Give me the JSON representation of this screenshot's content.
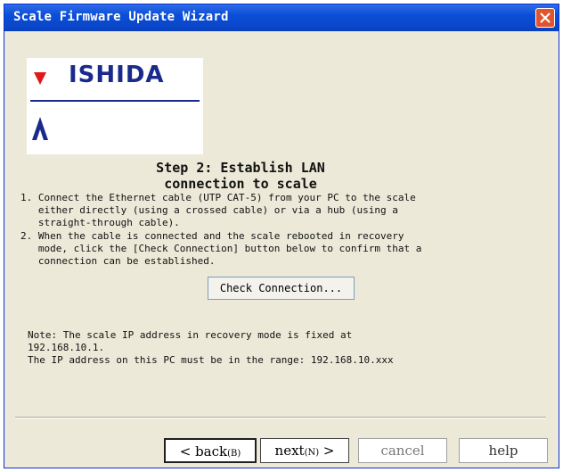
{
  "window": {
    "title": "Scale Firmware Update Wizard",
    "close_icon": "close-icon"
  },
  "logo": {
    "brand": "ISHIDA"
  },
  "step": {
    "heading_line1": "Step 2:  Establish LAN",
    "heading_line2": "connection to scale"
  },
  "instructions": [
    {
      "lines": [
        "1. Connect the Ethernet cable (UTP CAT-5) from your PC to the scale",
        "   either directly (using a crossed cable) or via a hub (using a",
        "   straight-through cable)."
      ]
    },
    {
      "lines": [
        "2. When the cable is connected and the scale rebooted in recovery",
        "   mode, click the [Check Connection] button below to confirm that a",
        "   connection can be established."
      ]
    }
  ],
  "check_button": {
    "label": "Check Connection..."
  },
  "note": {
    "lines": [
      "Note: The scale IP address in recovery mode is fixed at",
      "192.168.10.1.",
      "The IP address on this PC must be in the range: 192.168.10.xxx"
    ]
  },
  "buttons": {
    "back": {
      "label": "< back",
      "accel": "(B)"
    },
    "next": {
      "label": "next",
      "accel": "(N)",
      "suffix": " >"
    },
    "cancel": {
      "label": "cancel"
    },
    "help": {
      "label": "help"
    }
  },
  "colors": {
    "titlebar": "#0a4fd8",
    "close": "#e0552f",
    "logo_red": "#e01818",
    "logo_blue": "#1a2a8c",
    "dialog_bg": "#ece9d8"
  }
}
